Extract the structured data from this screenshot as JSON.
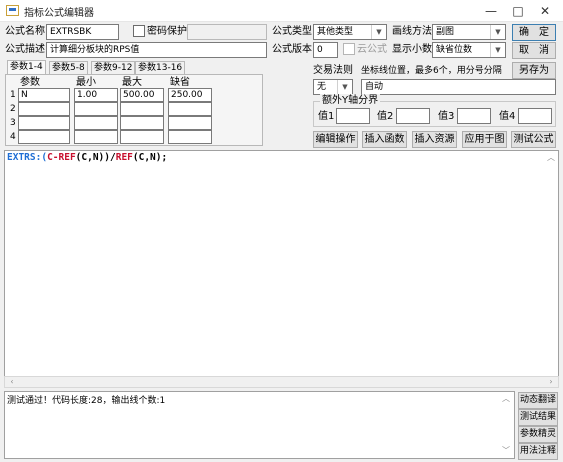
{
  "window": {
    "title": "指标公式编辑器",
    "minimize": "—",
    "maximize": "□",
    "close": "✕"
  },
  "formula": {
    "name_label": "公式名称",
    "name_value": "EXTRSBK",
    "password_label": "密码保护",
    "desc_label": "公式描述",
    "desc_value": "计算细分板块的RPS值",
    "type_label": "公式类型",
    "type_value": "其他类型",
    "draw_label": "画线方法",
    "draw_value": "副图",
    "version_label": "公式版本",
    "version_value": "0",
    "cloud_label": "云公式",
    "decimal_label": "显示小数",
    "decimal_value": "缺省位数"
  },
  "buttons": {
    "ok": "确　定",
    "cancel": "取　消",
    "save_as": "另存为",
    "edit_op": "编辑操作",
    "insert_func": "插入函数",
    "insert_res": "插入资源",
    "apply_chart": "应用于图",
    "test": "测试公式",
    "dyn_translate": "动态翻译",
    "test_result": "测试结果",
    "param_tune": "参数精灵",
    "usage_note": "用法注释"
  },
  "params": {
    "tabs": [
      "参数1-4",
      "参数5-8",
      "参数9-12",
      "参数13-16"
    ],
    "headers": [
      "参数",
      "最小",
      "最大",
      "缺省"
    ],
    "rows": [
      {
        "num": "1",
        "name": "N",
        "min": "1.00",
        "max": "500.00",
        "def": "250.00"
      },
      {
        "num": "2",
        "name": "",
        "min": "",
        "max": "",
        "def": ""
      },
      {
        "num": "3",
        "name": "",
        "min": "",
        "max": "",
        "def": ""
      },
      {
        "num": "4",
        "name": "",
        "min": "",
        "max": "",
        "def": ""
      }
    ]
  },
  "trade": {
    "rule_label": "交易法则",
    "rule_value": "无",
    "coord_label": "坐标线位置，最多6个，用分号分隔",
    "coord_value": "自动",
    "yaxis_label": "额外Y轴分界",
    "v1": "值1",
    "v2": "值2",
    "v3": "值3",
    "v4": "值4"
  },
  "code": {
    "name": "EXTRS",
    "op": ":(",
    "f1": "C-REF",
    "a1": "(C,N))/",
    "f2": "REF",
    "a2": "(C,N);"
  },
  "output": {
    "message": "测试通过！代码长度:28，输出线个数:1"
  },
  "colors": {
    "var_blue": "#1f6ed4",
    "func_red": "#c8102e",
    "op_black": "#000000"
  }
}
